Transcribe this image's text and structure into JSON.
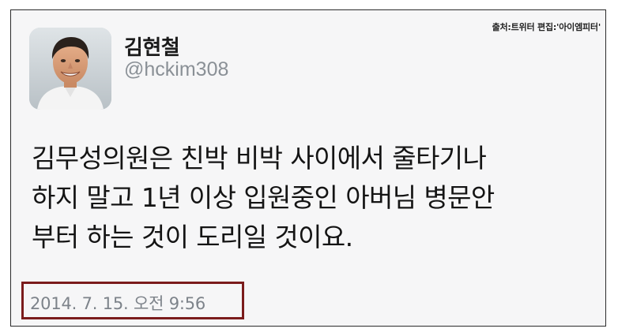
{
  "source_note": "출처:트위터 편집:'아이엠피터'",
  "user": {
    "display_name": "김현철",
    "handle": "@hckim308"
  },
  "tweet": {
    "lines": [
      "김무성의원은 친박 비박 사이에서 줄타기나",
      "하지 말고 1년 이상 입원중인 아버님 병문안",
      "부터 하는 것이 도리일 것이요."
    ],
    "timestamp": "2014. 7. 15. 오전 9:56"
  },
  "colors": {
    "background": "#f6f6f7",
    "text": "#141414",
    "muted": "#8a9096",
    "highlight_border": "#7b1c1c"
  },
  "icons": {
    "avatar": "profile-photo"
  }
}
